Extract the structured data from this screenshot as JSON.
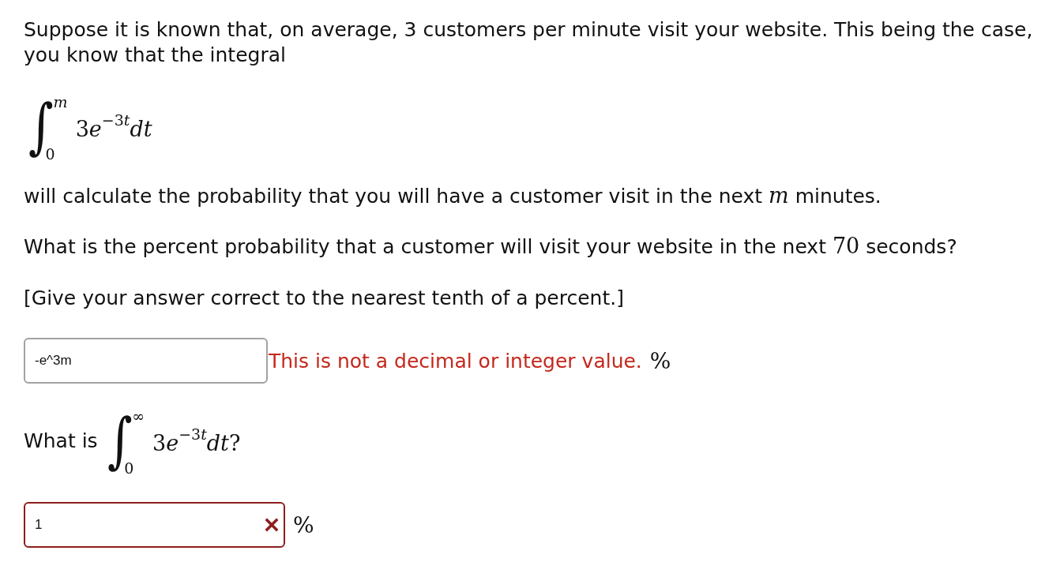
{
  "problem": {
    "intro": "Suppose it is known that, on average, 3 customers per minute visit your website. This being the case, you know that the integral",
    "integral": {
      "sign": "∫",
      "upper": {
        "kind": "var",
        "text": "m"
      },
      "lower": {
        "kind": "num",
        "text": "0"
      },
      "integrand": [
        {
          "kind": "num",
          "text": "3"
        },
        {
          "kind": "var",
          "text": "e"
        },
        {
          "kind": "sup_num",
          "text": "−3"
        },
        {
          "kind": "sup_var",
          "text": "t"
        },
        {
          "kind": "var",
          "text": "dt"
        }
      ]
    },
    "statement": [
      {
        "kind": "text",
        "text": "will calculate the probability that you will have a customer visit in the next "
      },
      {
        "kind": "var",
        "text": "m"
      },
      {
        "kind": "text",
        "text": " minutes."
      }
    ],
    "question": [
      {
        "kind": "text",
        "text": "What is the percent probability that a customer will visit your website in the next "
      },
      {
        "kind": "num",
        "text": "70"
      },
      {
        "kind": "text",
        "text": " seconds?"
      }
    ],
    "instruction": "[Give your answer correct to the nearest tenth of a percent.]",
    "answer": {
      "value": "-e^3m",
      "incorrect": false,
      "message": "This is not a decimal or integer value.",
      "unit": "%"
    }
  },
  "part_2": {
    "question": [
      {
        "kind": "text",
        "text": "What is "
      },
      {
        "kind": "integral",
        "sign": "∫",
        "upper": {
          "kind": "num",
          "text": "∞"
        },
        "lower": {
          "kind": "num",
          "text": "0"
        },
        "integrand": [
          {
            "kind": "num",
            "text": "3"
          },
          {
            "kind": "var",
            "text": "e"
          },
          {
            "kind": "sup_num",
            "text": "−3"
          },
          {
            "kind": "sup_var",
            "text": "t"
          },
          {
            "kind": "var",
            "text": "dt"
          },
          {
            "kind": "num",
            "text": "?"
          }
        ]
      }
    ],
    "answer": {
      "value": "1",
      "incorrect": true,
      "unit": "%"
    }
  }
}
